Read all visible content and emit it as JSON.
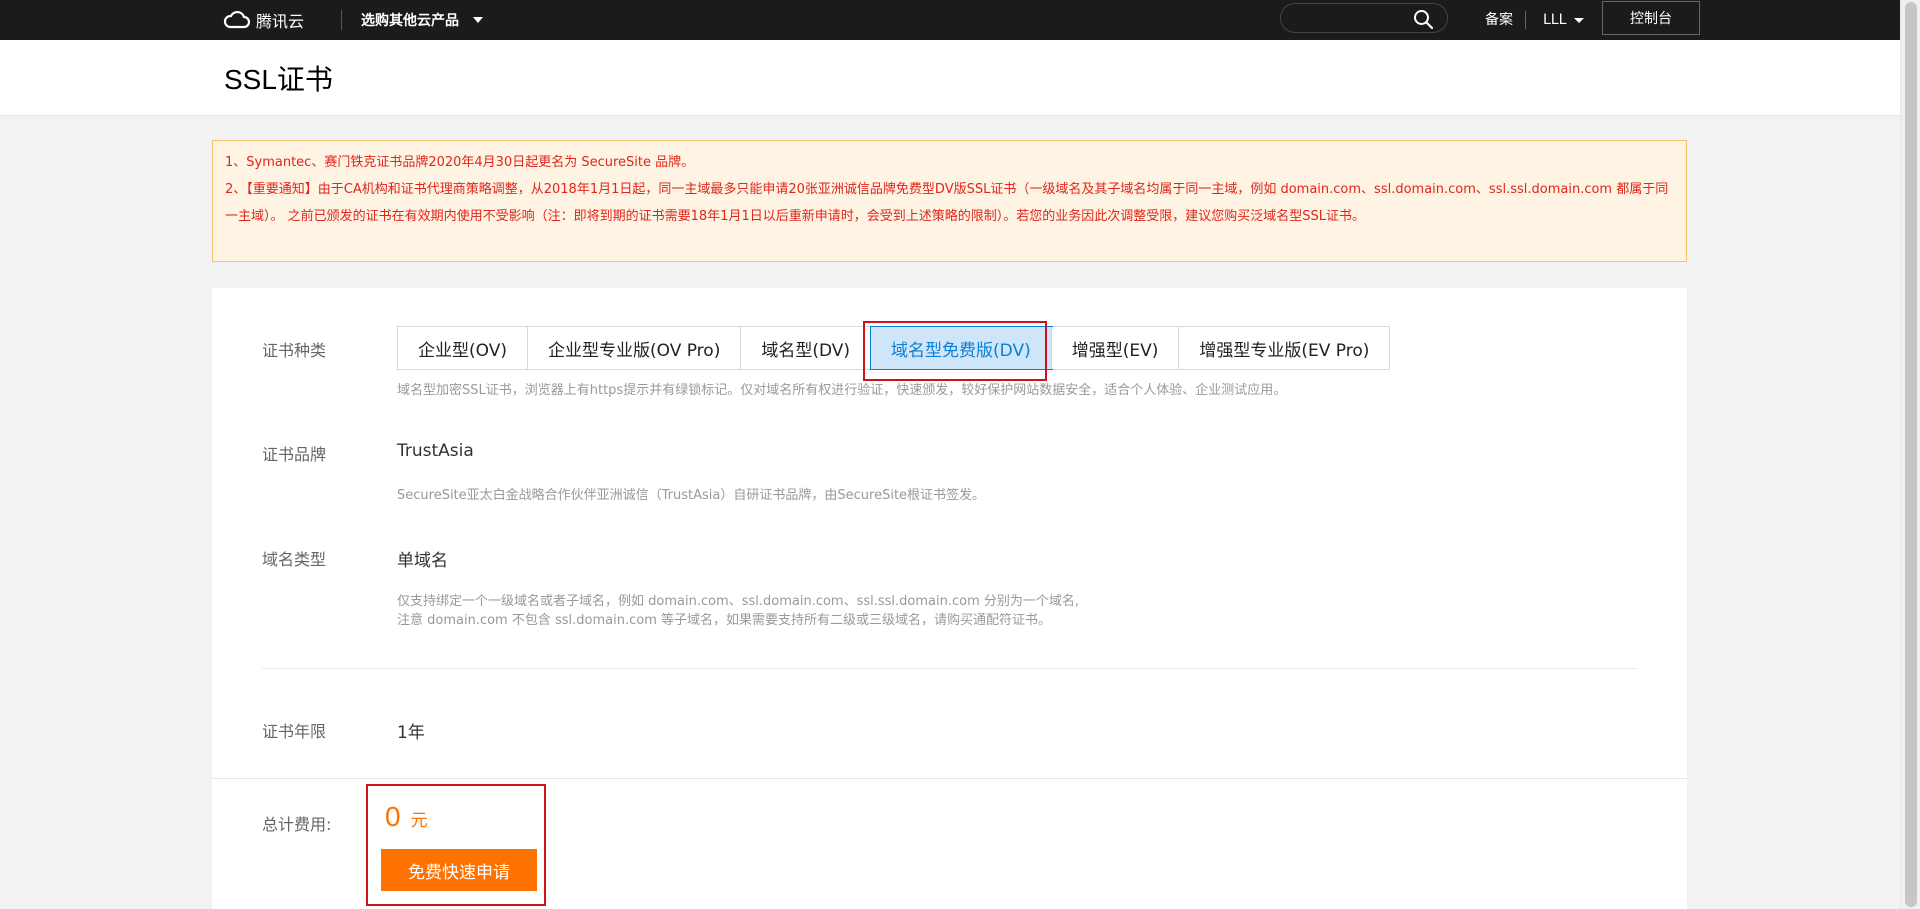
{
  "topbar": {
    "brand": "腾讯云",
    "products_label": "选购其他云产品",
    "search_placeholder": "",
    "beian_label": "备案",
    "user_label": "LLL",
    "console_label": "控制台"
  },
  "page": {
    "title": "SSL证书"
  },
  "notice": {
    "line1": "1、Symantec、赛门铁克证书品牌2020年4月30日起更名为 SecureSite 品牌。",
    "line2": "2、【重要通知】由于CA机构和证书代理商策略调整，从2018年1月1日起，同一主域最多只能申请20张亚洲诚信品牌免费型DV版SSL证书（一级域名及其子域名均属于同一主域，例如 domain.com、ssl.domain.com、ssl.ssl.domain.com 都属于同一主域）。 之前已颁发的证书在有效期内使用不受影响（注：即将到期的证书需要18年1月1日以后重新申请时，会受到上述策略的限制）。若您的业务因此次调整受限，建议您购买泛域名型SSL证书。"
  },
  "form": {
    "cert_type_label": "证书种类",
    "cert_types": [
      "企业型(OV)",
      "企业型专业版(OV Pro)",
      "域名型(DV)",
      "域名型免费版(DV)",
      "增强型(EV)",
      "增强型专业版(EV Pro)"
    ],
    "selected_cert_type": "域名型免费版(DV)",
    "cert_type_hint": "域名型加密SSL证书，浏览器上有https提示并有绿锁标记。仅对域名所有权进行验证，快速颁发，较好保护网站数据安全，适合个人体验、企业测试应用。",
    "brand_label": "证书品牌",
    "brand_value": "TrustAsia",
    "brand_hint": "SecureSite亚太白金战略合作伙伴亚洲诚信（TrustAsia）自研证书品牌，由SecureSite根证书签发。",
    "domain_type_label": "域名类型",
    "domain_type_value": "单域名",
    "domain_hint_1": "仅支持绑定一个一级域名或者子域名，例如 domain.com、ssl.domain.com、ssl.ssl.domain.com 分别为一个域名,",
    "domain_hint_2": "注意 domain.com 不包含 ssl.domain.com 等子域名，如果需要支持所有二级或三级域名，请购买通配符证书。",
    "term_label": "证书年限",
    "term_value": "1年"
  },
  "footer": {
    "total_label": "总计费用:",
    "price": "0",
    "unit": "元",
    "apply_label": "免费快速申请"
  },
  "colors": {
    "accent_orange": "#ff7200",
    "notice_red": "#e1251b",
    "selected_blue": "#0a7fd6",
    "highlight_red": "#d0101b"
  }
}
